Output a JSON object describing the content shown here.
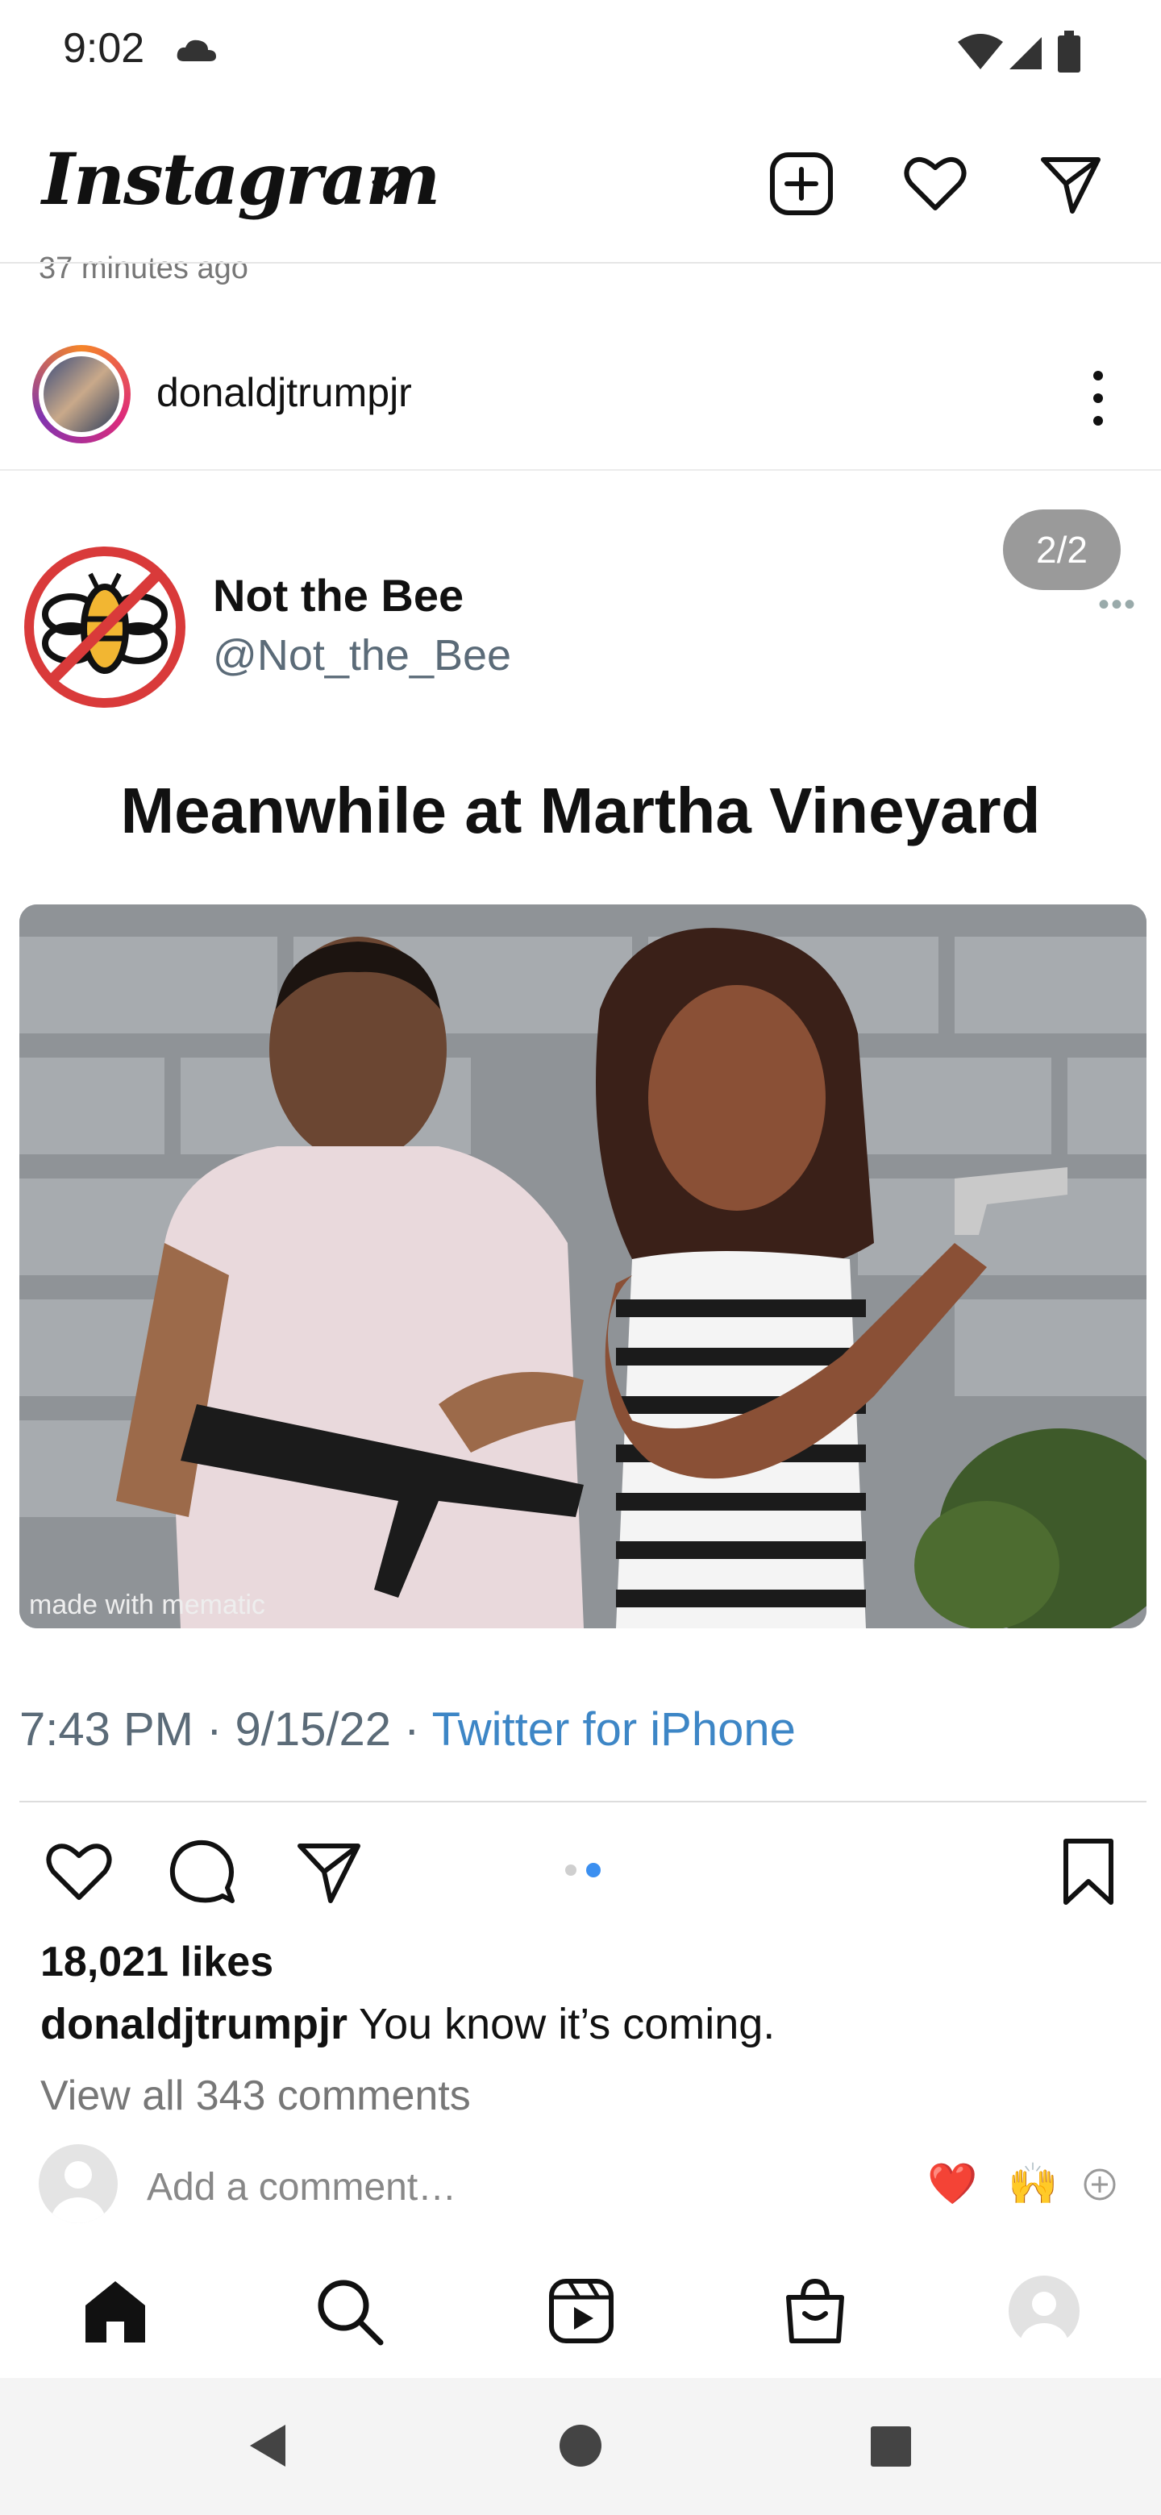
{
  "status_bar": {
    "time": "9:02"
  },
  "header": {
    "logo": "Instagram"
  },
  "feed": {
    "previous_post_time": "37 minutes ago"
  },
  "post": {
    "username": "donaldjtrumpjr",
    "carousel_counter": "2/2",
    "tweet": {
      "display_name": "Not the Bee",
      "handle": "@Not_the_Bee",
      "title": "Meanwhile at Martha Vineyard",
      "watermark": "made with mematic",
      "time_date": "7:43 PM · 9/15/22 · ",
      "source": "Twitter for iPhone"
    },
    "likes": "18,021 likes",
    "caption_user": "donaldjtrumpjr",
    "caption_text": " You know it’s coming.",
    "view_comments": "View all 343 comments",
    "add_comment_placeholder": "Add a comment…",
    "quick_emojis": [
      "❤️",
      "🙌"
    ]
  },
  "colors": {
    "accent_blue": "#3d86c6",
    "heart_red": "#e0303a"
  }
}
